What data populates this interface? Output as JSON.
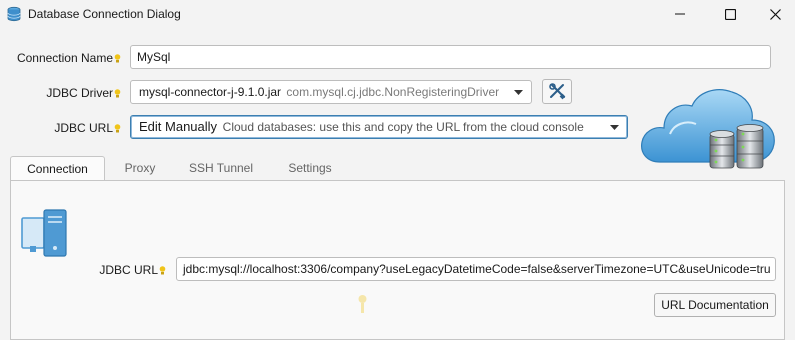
{
  "window": {
    "title": "Database Connection Dialog",
    "icon": "database-icon",
    "controls": [
      "minimize-icon",
      "maximize-icon",
      "close-icon"
    ]
  },
  "form": {
    "connection_name_label": "Connection Name",
    "connection_name_value": "MySql",
    "jdbc_driver_label": "JDBC Driver",
    "jdbc_driver_jar": "mysql-connector-j-9.1.0.jar",
    "jdbc_driver_class": "com.mysql.cj.jdbc.NonRegisteringDriver",
    "jdbc_url_label": "JDBC URL",
    "jdbc_url_mode": "Edit Manually",
    "jdbc_url_mode_hint": "Cloud databases: use this and copy the URL from the cloud console"
  },
  "tabs": [
    {
      "label": "Connection",
      "active": true
    },
    {
      "label": "Proxy",
      "active": false
    },
    {
      "label": "SSH Tunnel",
      "active": false
    },
    {
      "label": "Settings",
      "active": false
    }
  ],
  "connection_tab": {
    "jdbc_url_label": "JDBC URL",
    "jdbc_url_value": "jdbc:mysql://localhost:3306/company?useLegacyDatetimeCode=false&serverTimezone=UTC&useUnicode=tru",
    "url_doc_button": "URL Documentation"
  },
  "colors": {
    "bulb": "#f0c419",
    "focus_border": "#3c7fb1",
    "cloud_blue": "#4aa3df"
  }
}
